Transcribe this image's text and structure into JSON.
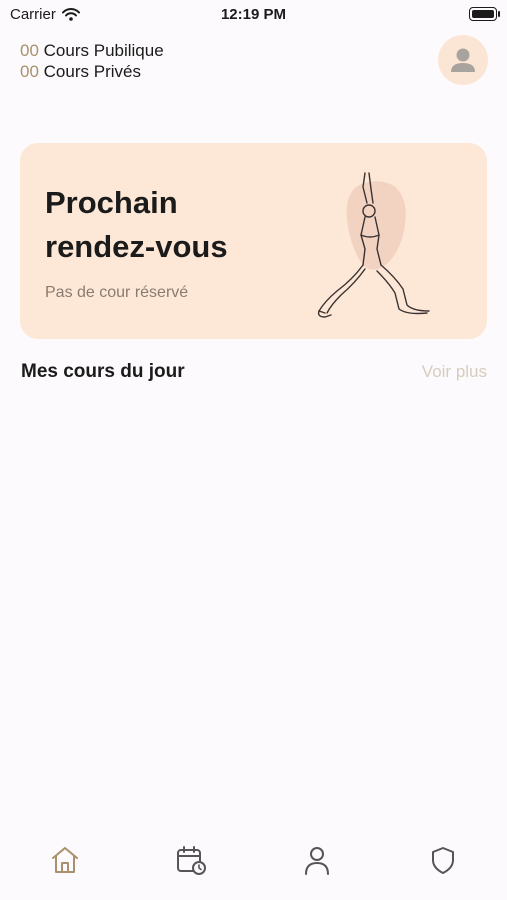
{
  "status_bar": {
    "carrier": "Carrier",
    "time": "12:19 PM"
  },
  "header": {
    "public_count": "00",
    "public_label": "Cours Pubilique",
    "private_count": "00",
    "private_label": "Cours Privés",
    "avatar_icon": "user-icon"
  },
  "card": {
    "title_line1": "Prochain",
    "title_line2": "rendez-vous",
    "subtitle": "Pas de cour réservé",
    "illustration": "yoga-pose-illustration"
  },
  "section": {
    "title": "Mes cours du jour",
    "link": "Voir plus"
  },
  "tabbar": {
    "items": [
      "home-icon",
      "calendar-clock-icon",
      "profile-icon",
      "shield-icon"
    ]
  },
  "colors": {
    "accent": "#A8916C",
    "card_bg": "#FDE8D8",
    "muted": "#D8CBBE",
    "background": "#FCFAFC"
  }
}
